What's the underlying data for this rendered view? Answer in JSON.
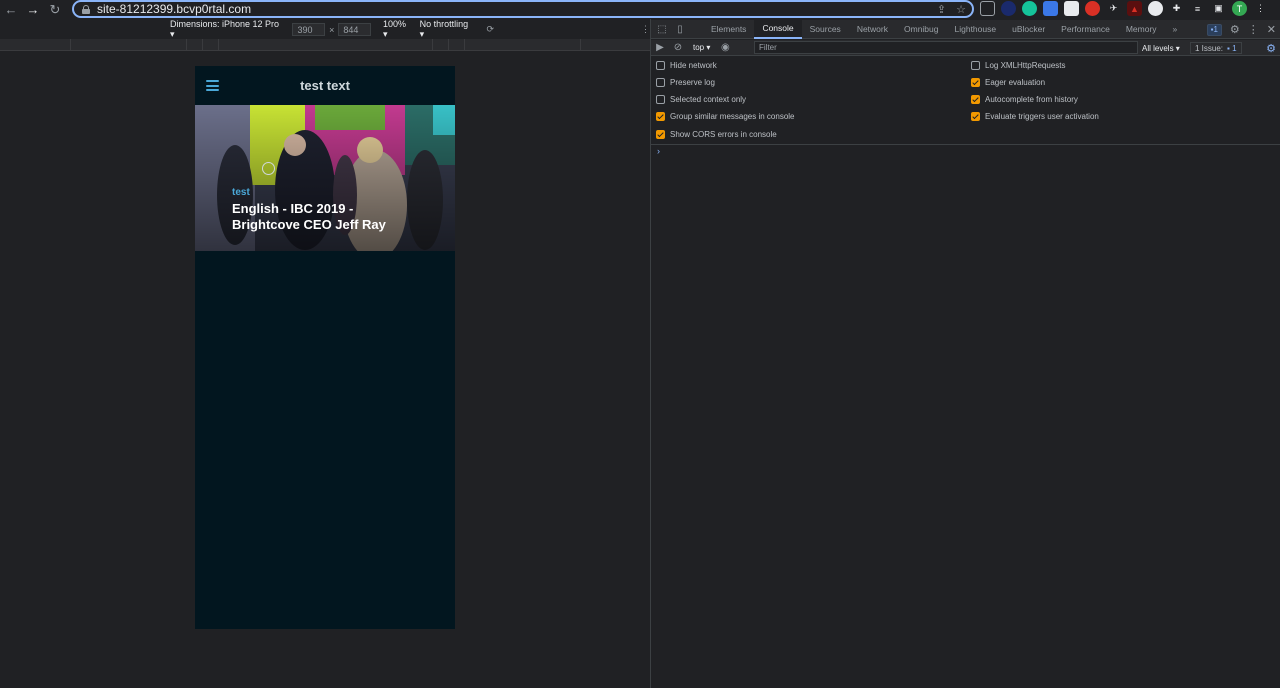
{
  "browser": {
    "url": "site-81212399.bcvp0rtal.com",
    "avatar_letter": "T"
  },
  "device_toolbar": {
    "dimensions_label": "Dimensions: iPhone 12 Pro",
    "width": "390",
    "height": "844",
    "zoom": "100%",
    "throttling": "No throttling"
  },
  "page": {
    "site_title": "test text",
    "hero_category": "test",
    "hero_title": "English - IBC 2019 - Brightcove CEO Jeff Ray"
  },
  "devtools": {
    "tabs": [
      "Elements",
      "Console",
      "Sources",
      "Network",
      "Omnibug",
      "Lighthouse",
      "uBlocker",
      "Performance",
      "Memory"
    ],
    "active_tab": "Console",
    "more_tabs": "»",
    "issues_badge": "1",
    "context": "top",
    "filter_placeholder": "Filter",
    "levels": "All levels",
    "issues_label": "1 Issue:",
    "issues_count": "1",
    "options_left": [
      {
        "label": "Hide network",
        "checked": false
      },
      {
        "label": "Preserve log",
        "checked": false
      },
      {
        "label": "Selected context only",
        "checked": false
      },
      {
        "label": "Group similar messages in console",
        "checked": true
      },
      {
        "label": "Show CORS errors in console",
        "checked": true
      }
    ],
    "options_right": [
      {
        "label": "Log XMLHttpRequests",
        "checked": false
      },
      {
        "label": "Eager evaluation",
        "checked": true
      },
      {
        "label": "Autocomplete from history",
        "checked": true
      },
      {
        "label": "Evaluate triggers user activation",
        "checked": true
      }
    ],
    "prompt": "›"
  },
  "colors": {
    "accent": "#8ab4f8",
    "checkbox_on": "#f29900",
    "page_bg": "#02161f",
    "link_blue": "#4aa8d8"
  }
}
